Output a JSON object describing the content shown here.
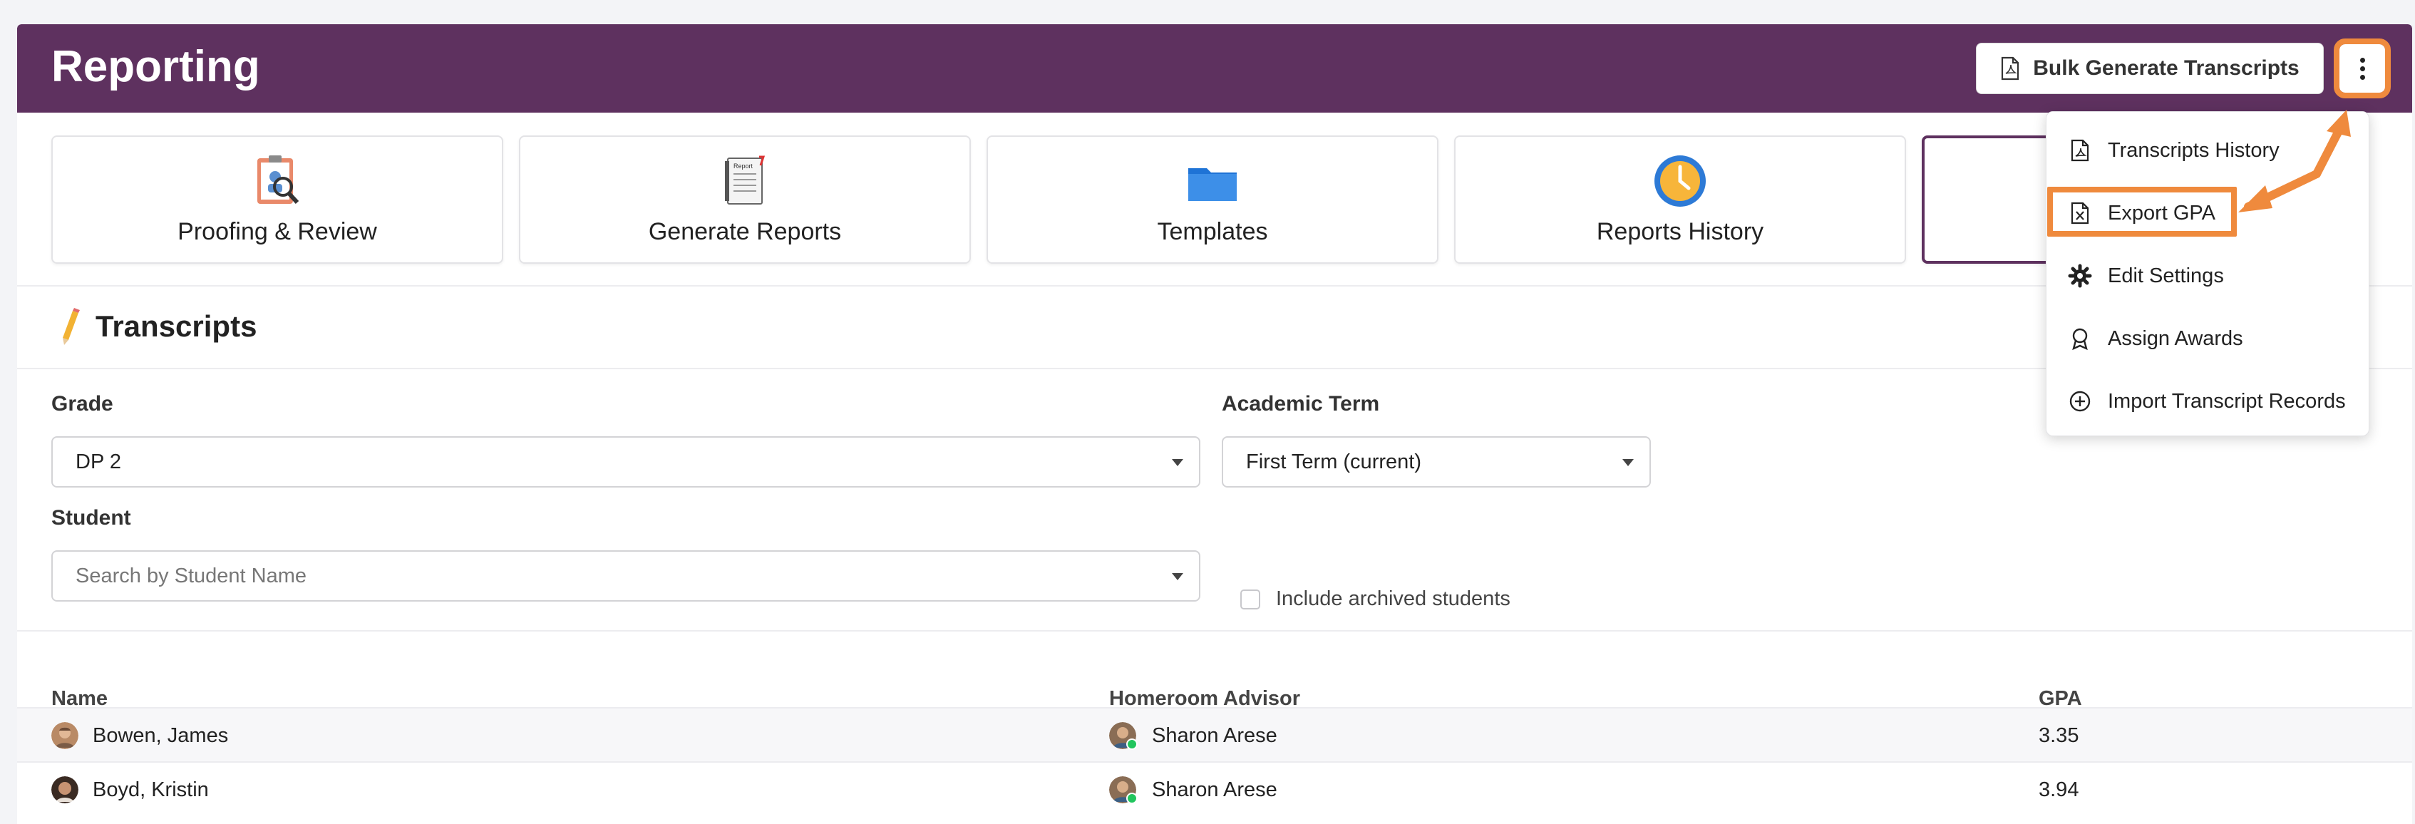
{
  "header": {
    "title": "Reporting",
    "bulk_button_label": "Bulk Generate Transcripts"
  },
  "tiles": [
    {
      "label": "Proofing & Review"
    },
    {
      "label": "Generate Reports"
    },
    {
      "label": "Templates"
    },
    {
      "label": "Reports History"
    },
    {
      "label": ""
    }
  ],
  "section": {
    "title": "Transcripts"
  },
  "filters": {
    "grade_label": "Grade",
    "grade_value": "DP 2",
    "term_label": "Academic Term",
    "term_value": "First Term (current)",
    "student_label": "Student",
    "student_placeholder": "Search by Student Name",
    "archived_label": "Include archived students"
  },
  "table": {
    "headers": {
      "name": "Name",
      "advisor": "Homeroom Advisor",
      "gpa": "GPA"
    },
    "rows": [
      {
        "name": "Bowen, James",
        "advisor": "Sharon Arese",
        "gpa": "3.35"
      },
      {
        "name": "Boyd, Kristin",
        "advisor": "Sharon Arese",
        "gpa": "3.94"
      }
    ]
  },
  "menu": {
    "items": [
      {
        "label": "Transcripts History",
        "icon": "pdf-file-icon"
      },
      {
        "label": "Export GPA",
        "icon": "excel-file-icon"
      },
      {
        "label": "Edit Settings",
        "icon": "gear-icon"
      },
      {
        "label": "Assign Awards",
        "icon": "award-icon"
      },
      {
        "label": "Import Transcript Records",
        "icon": "plus-circle-icon"
      }
    ]
  },
  "colors": {
    "header": "#5e315f",
    "highlight": "#ef8a3d",
    "online": "#21c55d"
  }
}
